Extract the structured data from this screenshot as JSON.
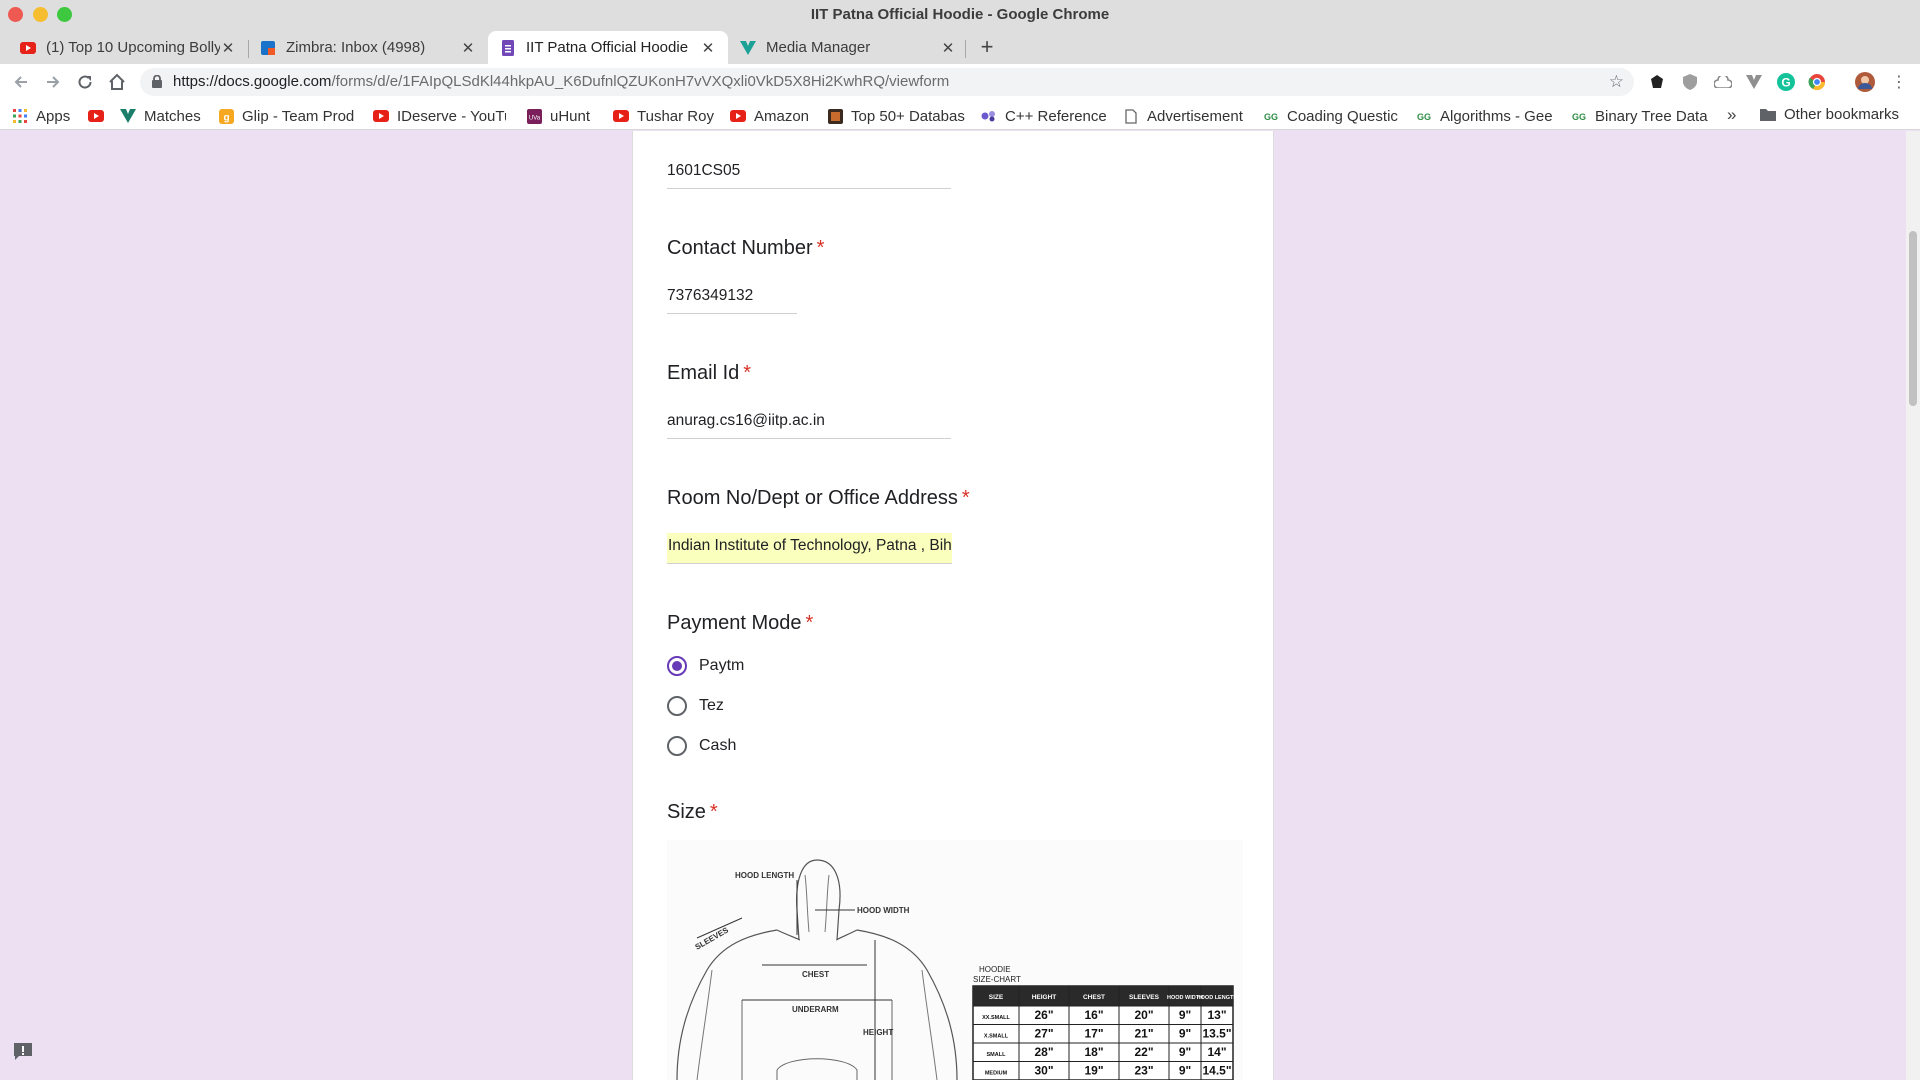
{
  "window": {
    "title": "IIT Patna Official Hoodie - Google Chrome"
  },
  "tabs": [
    {
      "title": "(1) Top 10 Upcoming Bolly",
      "icon": "youtube-icon",
      "active": false
    },
    {
      "title": "Zimbra: Inbox (4998)",
      "icon": "zimbra-icon",
      "active": false
    },
    {
      "title": "IIT Patna Official Hoodie",
      "icon": "google-forms-icon",
      "active": true
    },
    {
      "title": "Media Manager",
      "icon": "vuetify-icon",
      "active": false
    }
  ],
  "toolbar": {
    "url_host": "https://docs.google.com",
    "url_path": "/forms/d/e/1FAIpQLSdKl44hkpAU_K6DufnlQZUKonH7vVXQxli0VkD5X8Hi2KwhRQ/viewform"
  },
  "bookmarks": {
    "items": [
      {
        "label": "Apps",
        "icon": "apps-grid-icon"
      },
      {
        "label": "",
        "icon": "youtube-icon"
      },
      {
        "label": "Matches",
        "icon": "vuetify-icon"
      },
      {
        "label": "Glip - Team Prod",
        "icon": "glip-icon"
      },
      {
        "label": "IDeserve - YouTu",
        "icon": "youtube-icon"
      },
      {
        "label": "uHunt",
        "icon": "uhunt-icon"
      },
      {
        "label": "Tushar Roy",
        "icon": "youtube-icon"
      },
      {
        "label": "Amazon",
        "icon": "youtube-icon"
      },
      {
        "label": "Top 50+ Databas",
        "icon": "database-icon"
      },
      {
        "label": "C++ Reference",
        "icon": "cpp-icon"
      },
      {
        "label": "Advertisement",
        "icon": "page-icon"
      },
      {
        "label": "Coading Questic",
        "icon": "geeksforgeeks-icon"
      },
      {
        "label": "Algorithms - Gee",
        "icon": "geeksforgeeks-icon"
      },
      {
        "label": "Binary Tree Data",
        "icon": "geeksforgeeks-icon"
      }
    ],
    "more": "»",
    "other": "Other bookmarks"
  },
  "form": {
    "roll_value": "1601CS05",
    "contact": {
      "label": "Contact Number",
      "value": "7376349132"
    },
    "email": {
      "label": "Email Id",
      "value": "anurag.cs16@iitp.ac.in"
    },
    "address": {
      "label": "Room No/Dept or Office Address",
      "value": "Indian Institute of Technology, Patna , Bihta"
    },
    "payment": {
      "label": "Payment Mode",
      "options": [
        "Paytm",
        "Tez",
        "Cash"
      ],
      "selected": "Paytm"
    },
    "size": {
      "label": "Size"
    },
    "required_mark": "*"
  },
  "size_chart": {
    "title_line1": "HOODIE",
    "title_line2": "SIZE-CHART",
    "diagram_labels": [
      "HOOD LENGTH",
      "HOOD WIDTH",
      "SLEEVES",
      "CHEST",
      "UNDERARM",
      "HEIGHT"
    ],
    "headers": [
      "SIZE",
      "HEIGHT",
      "CHEST",
      "SLEEVES",
      "HOOD WIDTH",
      "HOOD LENGTH"
    ],
    "rows": [
      [
        "XX.SMALL",
        "26\"",
        "16\"",
        "20\"",
        "9\"",
        "13\""
      ],
      [
        "X.SMALL",
        "27\"",
        "17\"",
        "21\"",
        "9\"",
        "13.5\""
      ],
      [
        "SMALL",
        "28\"",
        "18\"",
        "22\"",
        "9\"",
        "14\""
      ],
      [
        "MEDIUM",
        "30\"",
        "19\"",
        "23\"",
        "9\"",
        "14.5\""
      ]
    ]
  },
  "colors": {
    "accent": "#673ab7",
    "required": "#d93025",
    "page_bg": "#ede0f3",
    "autofill": "#faffbd"
  }
}
